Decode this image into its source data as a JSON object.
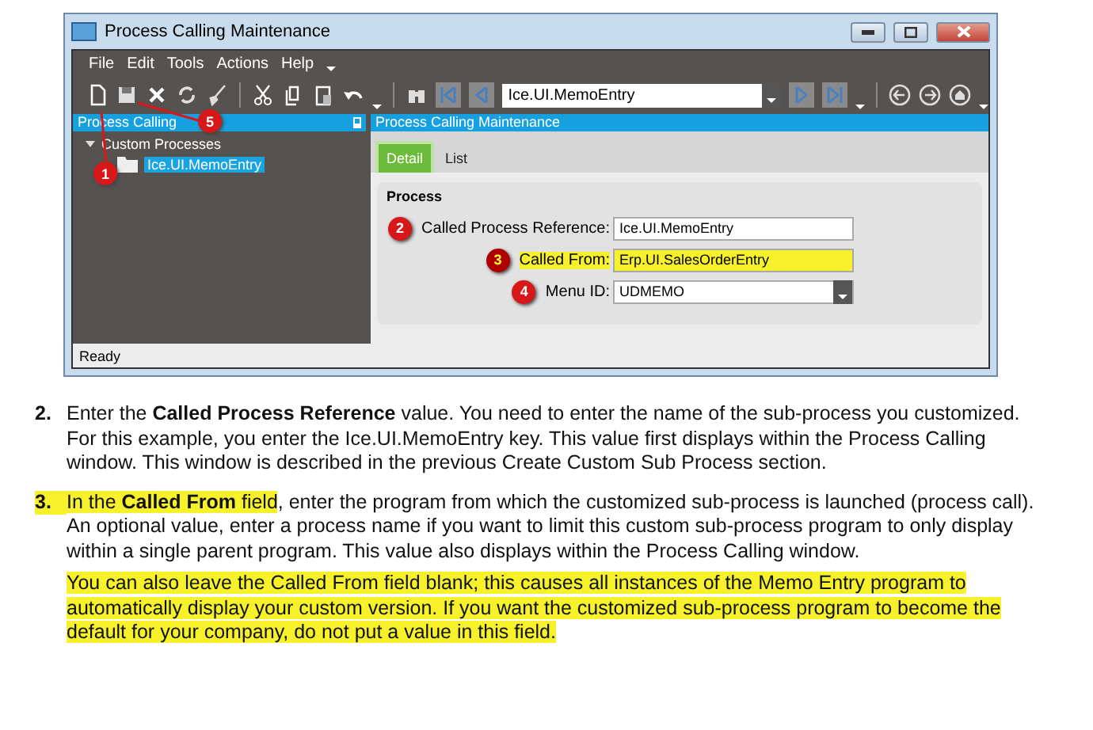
{
  "window": {
    "title": "Process Calling Maintenance"
  },
  "menu": [
    "File",
    "Edit",
    "Tools",
    "Actions",
    "Help"
  ],
  "toolbar": {
    "key_field": "Ice.UI.MemoEntry"
  },
  "tree_panel": {
    "title": "Process Calling",
    "root": {
      "label": "Custom Processes",
      "expanded": true,
      "children": [
        {
          "label": "Ice.UI.MemoEntry",
          "selected": true
        }
      ]
    }
  },
  "detail_panel": {
    "title": "Process Calling Maintenance",
    "tabs": [
      {
        "label": "Detail",
        "selected": true
      },
      {
        "label": "List",
        "selected": false
      }
    ],
    "group": {
      "title": "Process",
      "fields": [
        {
          "callout": "2",
          "label": "Called Process Reference:",
          "value": "Ice.UI.MemoEntry",
          "kind": "text",
          "highlighted": false
        },
        {
          "callout": "3",
          "label": "Called From:",
          "value": "Erp.UI.SalesOrderEntry",
          "kind": "text",
          "highlighted": true
        },
        {
          "callout": "4",
          "label": "Menu ID:",
          "value": "UDMEMO",
          "kind": "dropdown",
          "highlighted": false
        }
      ]
    }
  },
  "callouts": [
    "1",
    "5"
  ],
  "status_bar": "Ready",
  "steps": [
    {
      "number": "2.",
      "highlighted": false,
      "text": "Enter the **Called Process Reference** value. You need to enter the name of the sub-process you customized. For this example, you enter the Ice.UI.MemoEntry key. This value first displays within the Process Calling window. This window is described in the previous Create Custom Sub Process section."
    },
    {
      "number": "3.",
      "highlighted": true,
      "lead": "In the **Called From** field",
      "text": ", enter the program from which the customized sub-process is launched (process call). An optional value, enter a process name if you want to limit this custom sub-process program to only display within a single parent program. This value also displays within the Process Calling window.",
      "note": "You can also leave the Called From field blank; this causes all instances of the Memo Entry program to automatically display your custom version. If you want the customized sub-process program to become the default for your company, do not put a value in this field."
    }
  ]
}
